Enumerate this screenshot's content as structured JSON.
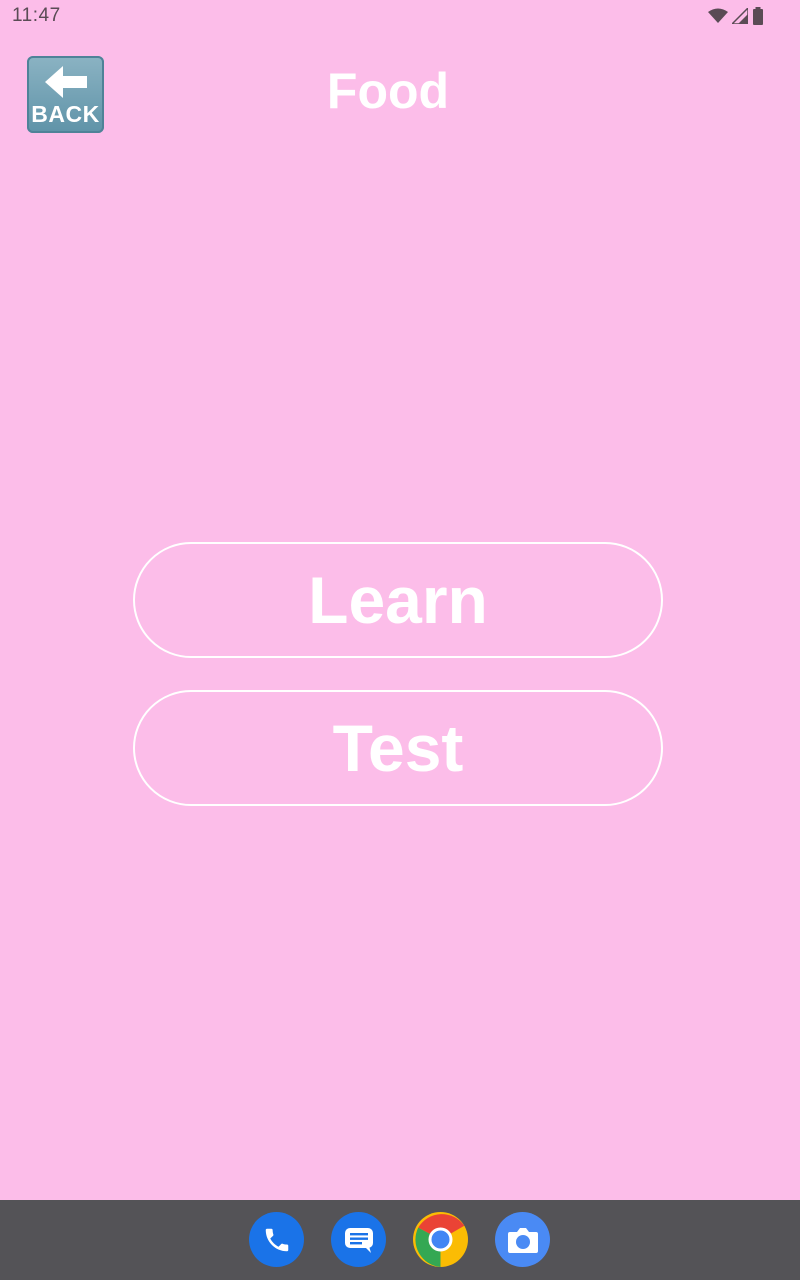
{
  "status_bar": {
    "time": "11:47",
    "icons": [
      "wifi-icon",
      "cell-signal-icon",
      "battery-icon"
    ]
  },
  "header": {
    "back_label": "BACK",
    "title": "Food"
  },
  "main": {
    "learn_label": "Learn",
    "test_label": "Test"
  },
  "dock": {
    "apps": [
      "phone-icon",
      "messages-icon",
      "chrome-icon",
      "camera-icon"
    ]
  },
  "colors": {
    "background": "#fcbde9",
    "text": "#ffffff",
    "dock": "#545357",
    "back_button": "#6c9bb0"
  }
}
